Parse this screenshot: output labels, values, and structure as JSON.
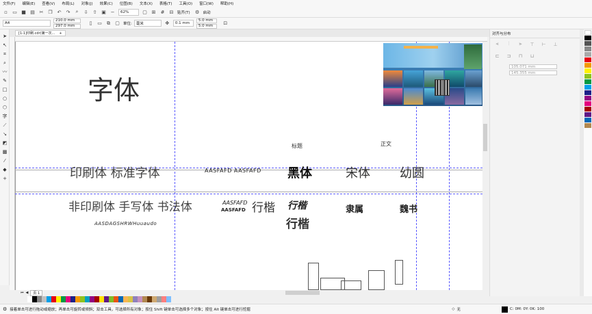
{
  "menu": [
    "文件(F)",
    "编辑(E)",
    "查看(V)",
    "布局(L)",
    "对象(J)",
    "效果(C)",
    "位图(B)",
    "文本(X)",
    "表格(T)",
    "工具(O)",
    "窗口(W)",
    "帮助(H)"
  ],
  "toolbar": {
    "zoom": "62%",
    "snap": "贴齐(T)",
    "launch": "启动"
  },
  "propbar": {
    "page_size": "A4",
    "width": "210.0 mm",
    "height": "297.0 mm",
    "unit_label": "单位:",
    "unit": "毫米",
    "nudge": "0.1 mm",
    "dup_x": "5.0 mm",
    "dup_y": "5.0 mm"
  },
  "document_tab": "[1-1]印刷.cdr(第一次...",
  "page_tab": "页 1",
  "right_panel": {
    "title": "对齐与分布",
    "x": "105.071 mm",
    "y": "145.355 mm"
  },
  "canvas": {
    "heading": "字体",
    "label_title": "标题",
    "label_body": "正文",
    "row1_left": "印刷体 标准字体",
    "row1_latin": "AASFAFD AASFAFD",
    "row1_fonts": [
      "黑体",
      "宋体",
      "幼圆"
    ],
    "row2_left": "非印刷体 手写体 书法体",
    "row2_latin_top": "AASFAFD",
    "row2_latin_bottom": "AASFAFD",
    "row2_xingkai": "行楷",
    "row2_fonts": [
      "行楷",
      "隶属",
      "魏书"
    ],
    "row2_xingkai2": "行楷",
    "script_sample": "AASDAGSHRWHuuaudo"
  },
  "status": {
    "hint": "接着单击可进行拖动或缩放；再单击可旋转或倾斜；双击工具，可选择所有对象；按住 Shift 键单击可选择多个对象；按住 Alt 键单击可进行挖掘",
    "fill": "无",
    "color": "C: 0M: 0Y: 0K: 100"
  },
  "palette_colors": [
    "#ffffff",
    "#000000",
    "#888888",
    "#c0c0c0",
    "#00a0e9",
    "#e60012",
    "#fff100",
    "#009944",
    "#e4007f",
    "#1d2088",
    "#f39800",
    "#8fc31f",
    "#00a0c1",
    "#920783",
    "#a40000",
    "#ffe100",
    "#601986",
    "#7fbe26",
    "#ea5514",
    "#0068b7",
    "#f8b551",
    "#d7c447",
    "#8f82bc",
    "#c490bf",
    "#b28850",
    "#6a3906",
    "#cfa972",
    "#9e9e9e",
    "#ff7f7f",
    "#7fbfff"
  ]
}
